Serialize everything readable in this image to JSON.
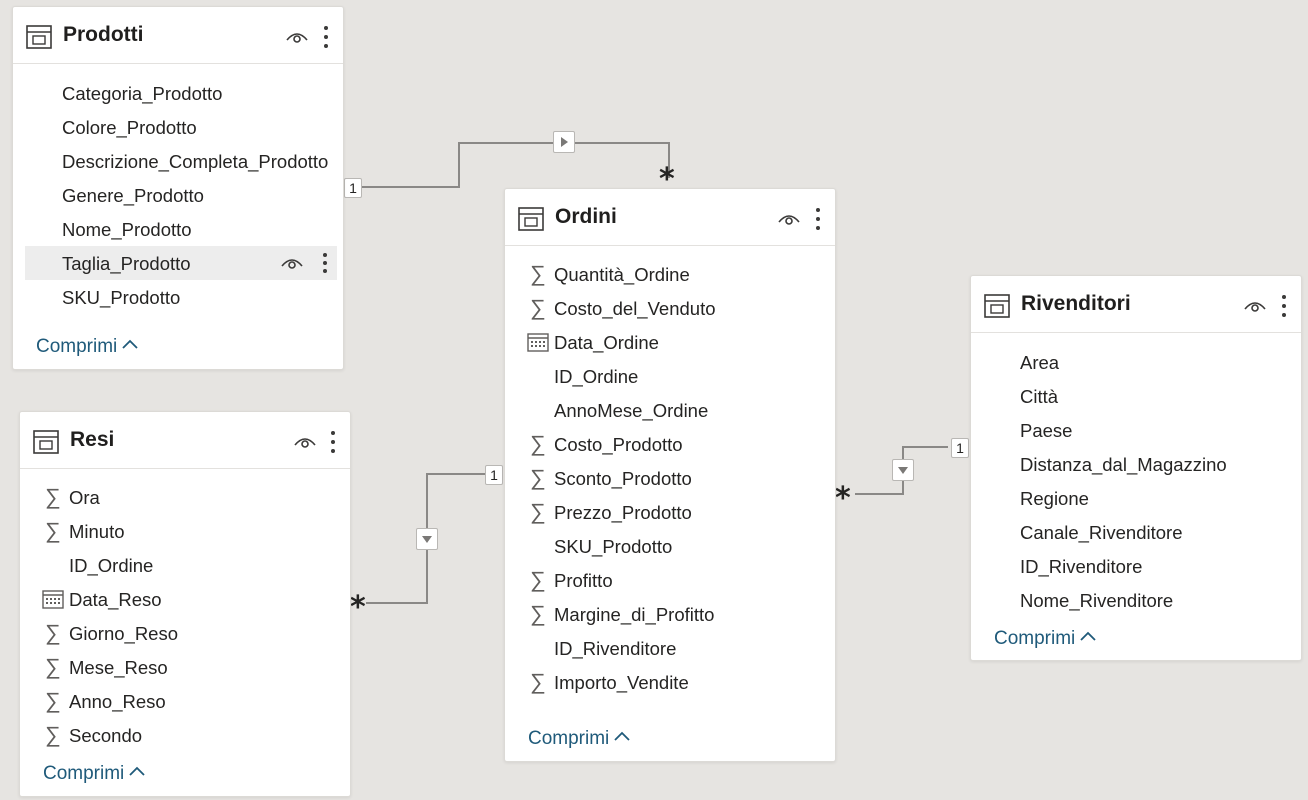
{
  "tables": [
    {
      "title": "Prodotti",
      "icon": "table-icon",
      "collapse_label": "Comprimi",
      "fields": [
        {
          "label": "Categoria_Prodotto",
          "icon": "none"
        },
        {
          "label": "Colore_Prodotto",
          "icon": "none"
        },
        {
          "label": "Descrizione_Completa_Prodotto",
          "icon": "none"
        },
        {
          "label": "Genere_Prodotto",
          "icon": "none"
        },
        {
          "label": "Nome_Prodotto",
          "icon": "none"
        },
        {
          "label": "Taglia_Prodotto",
          "icon": "none",
          "highlighted": true
        },
        {
          "label": "SKU_Prodotto",
          "icon": "none"
        }
      ]
    },
    {
      "title": "Resi",
      "icon": "table-icon",
      "collapse_label": "Comprimi",
      "fields": [
        {
          "label": "Ora",
          "icon": "sigma-icon"
        },
        {
          "label": "Minuto",
          "icon": "sigma-icon"
        },
        {
          "label": "ID_Ordine",
          "icon": "none"
        },
        {
          "label": "Data_Reso",
          "icon": "calendar-icon"
        },
        {
          "label": "Giorno_Reso",
          "icon": "sigma-icon"
        },
        {
          "label": "Mese_Reso",
          "icon": "sigma-icon"
        },
        {
          "label": "Anno_Reso",
          "icon": "sigma-icon"
        },
        {
          "label": "Secondo",
          "icon": "sigma-icon"
        }
      ]
    },
    {
      "title": "Ordini",
      "icon": "table-icon",
      "collapse_label": "Comprimi",
      "fields": [
        {
          "label": "Quantità_Ordine",
          "icon": "sigma-icon"
        },
        {
          "label": "Costo_del_Venduto",
          "icon": "sigma-icon"
        },
        {
          "label": "Data_Ordine",
          "icon": "calendar-icon"
        },
        {
          "label": "ID_Ordine",
          "icon": "none"
        },
        {
          "label": "AnnoMese_Ordine",
          "icon": "none"
        },
        {
          "label": "Costo_Prodotto",
          "icon": "sigma-icon"
        },
        {
          "label": "Sconto_Prodotto",
          "icon": "sigma-icon"
        },
        {
          "label": "Prezzo_Prodotto",
          "icon": "sigma-icon"
        },
        {
          "label": "SKU_Prodotto",
          "icon": "none"
        },
        {
          "label": "Profitto",
          "icon": "sigma-icon"
        },
        {
          "label": "Margine_di_Profitto",
          "icon": "sigma-icon"
        },
        {
          "label": "ID_Rivenditore",
          "icon": "none"
        },
        {
          "label": "Importo_Vendite",
          "icon": "sigma-icon"
        }
      ]
    },
    {
      "title": "Rivenditori",
      "icon": "table-icon",
      "collapse_label": "Comprimi",
      "fields": [
        {
          "label": "Area",
          "icon": "none"
        },
        {
          "label": "Città",
          "icon": "none"
        },
        {
          "label": "Paese",
          "icon": "none"
        },
        {
          "label": "Distanza_dal_Magazzino",
          "icon": "none"
        },
        {
          "label": "Regione",
          "icon": "none"
        },
        {
          "label": "Canale_Rivenditore",
          "icon": "none"
        },
        {
          "label": "ID_Rivenditore",
          "icon": "none"
        },
        {
          "label": "Nome_Rivenditore",
          "icon": "none"
        }
      ]
    }
  ],
  "relationships": [
    {
      "from": "Prodotti",
      "to": "Ordini",
      "one_label": "1",
      "many_label": "*",
      "direction": "right"
    },
    {
      "from": "Resi",
      "to": "Ordini",
      "one_label": "1",
      "many_label": "*",
      "direction": "down"
    },
    {
      "from": "Rivenditori",
      "to": "Ordini",
      "one_label": "1",
      "many_label": "*",
      "direction": "down"
    }
  ],
  "colors": {
    "canvas": "#e6e4e1",
    "card": "#ffffff",
    "collapse_link": "#1f5a7a",
    "connector": "#8a8886",
    "row_highlight": "#ededed"
  }
}
